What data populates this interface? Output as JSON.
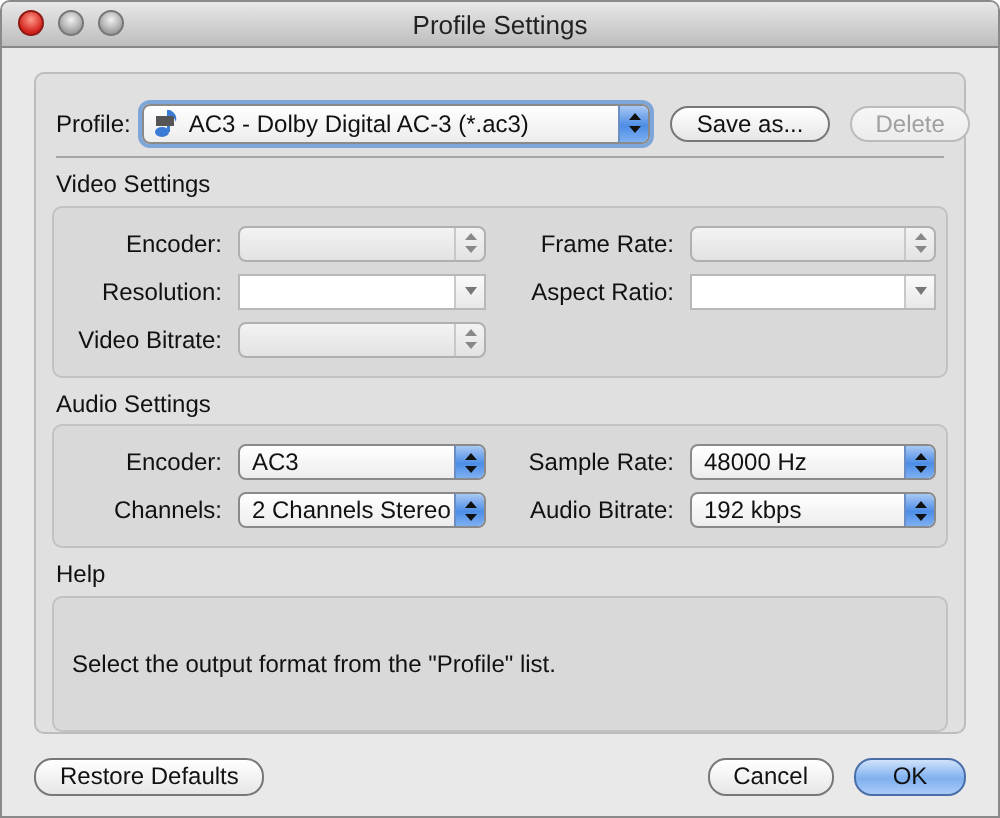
{
  "window": {
    "title": "Profile Settings"
  },
  "profile": {
    "label": "Profile:",
    "value": "AC3 - Dolby Digital AC-3 (*.ac3)",
    "focused": true
  },
  "profile_buttons": [
    {
      "label": "Save as...",
      "disabled": false
    },
    {
      "label": "Delete",
      "disabled": true
    }
  ],
  "sections": [
    {
      "title": "Video Settings",
      "fields": [
        {
          "label": "Encoder:",
          "kind": "popup",
          "disabled": true
        },
        {
          "label": "Frame Rate:",
          "kind": "popup",
          "disabled": true
        },
        {
          "label": "Resolution:",
          "kind": "combo",
          "disabled": false
        },
        {
          "label": "Aspect Ratio:",
          "kind": "combo",
          "disabled": false
        },
        {
          "label": "Video Bitrate:",
          "kind": "popup",
          "disabled": true
        }
      ]
    },
    {
      "title": "Audio Settings",
      "fields": [
        {
          "label": "Encoder:",
          "kind": "popup",
          "disabled": false,
          "value": "AC3"
        },
        {
          "label": "Sample Rate:",
          "kind": "popup",
          "disabled": false,
          "value": "48000 Hz"
        },
        {
          "label": "Channels:",
          "kind": "popup",
          "disabled": false,
          "value": "2 Channels Stereo"
        },
        {
          "label": "Audio Bitrate:",
          "kind": "popup",
          "disabled": false,
          "value": "192 kbps"
        }
      ]
    }
  ],
  "help": {
    "title": "Help",
    "text": "Select the output format from the \"Profile\" list."
  },
  "footer_buttons": [
    {
      "label": "Restore Defaults",
      "default": false
    },
    {
      "label": "Cancel",
      "default": false
    },
    {
      "label": "OK",
      "default": true
    }
  ]
}
